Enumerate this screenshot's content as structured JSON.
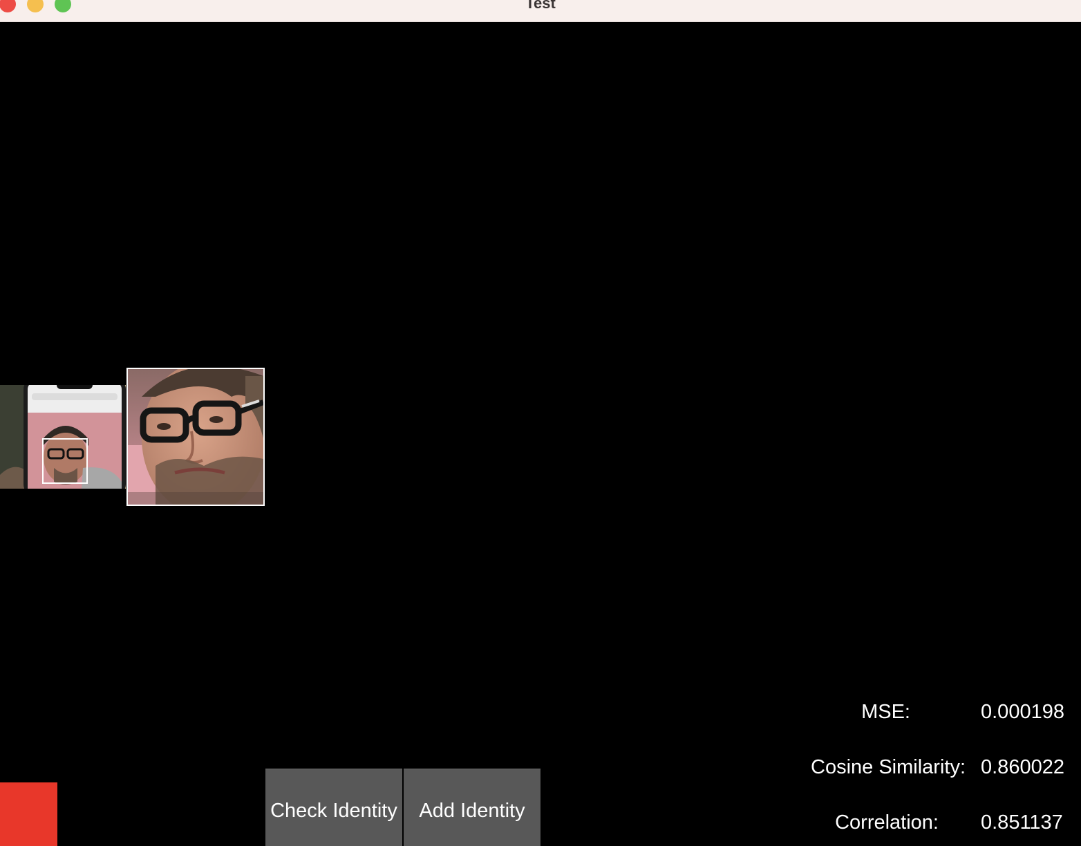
{
  "window": {
    "title": "Test",
    "traffic_lights": {
      "close_color": "#ed4c45",
      "minimize_color": "#f5bf4f",
      "zoom_color": "#5fc454"
    }
  },
  "preview": {
    "camera_frame_icon": "camera-frame-image",
    "face_crop_icon": "face-crop-image"
  },
  "buttons": {
    "check_identity": "Check Identity",
    "add_identity": "Add Identity"
  },
  "status": {
    "color": "#e8372a"
  },
  "metrics": [
    {
      "label": "MSE:",
      "value": "0.000198"
    },
    {
      "label": "Cosine Similarity:",
      "value": "0.860022"
    },
    {
      "label": "Correlation:",
      "value": "0.851137"
    }
  ]
}
